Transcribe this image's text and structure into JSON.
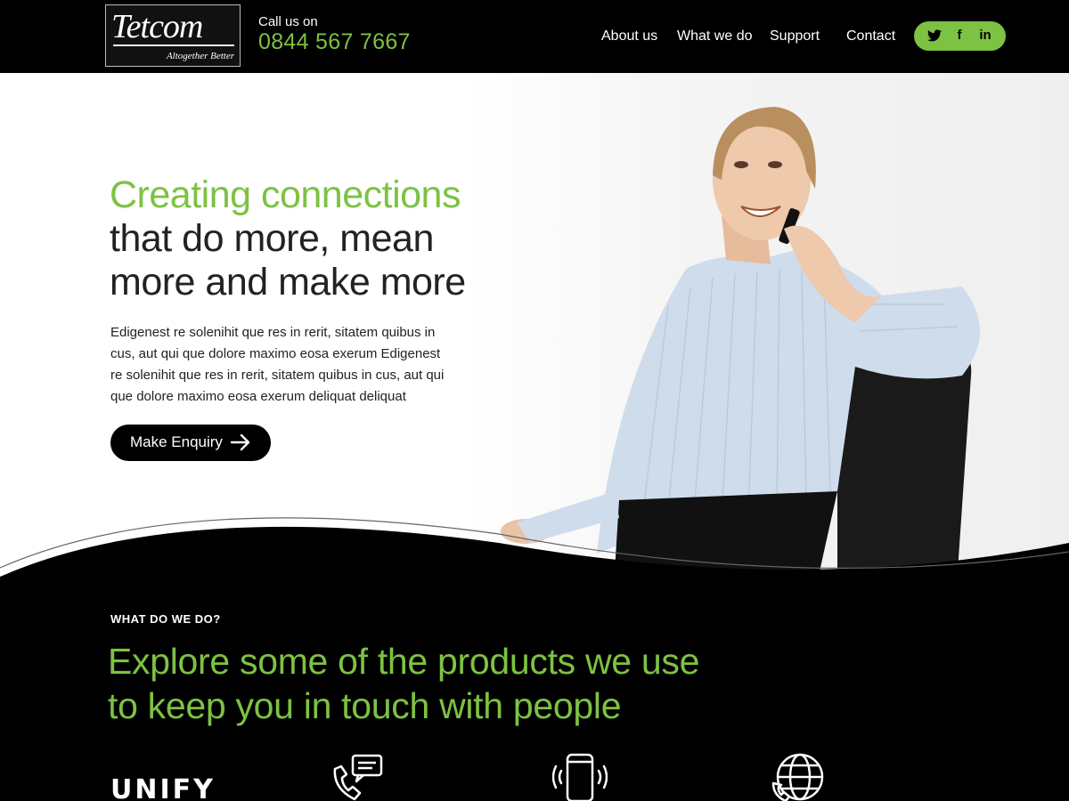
{
  "header": {
    "logo": {
      "name": "Tetcom",
      "tagline": "Altogether Better"
    },
    "call_label": "Call us on",
    "phone": "0844 567 7667",
    "nav": [
      {
        "label": "About us"
      },
      {
        "label": "What we do"
      },
      {
        "label": "Support"
      },
      {
        "label": "Contact"
      }
    ],
    "social": [
      {
        "icon": "twitter-icon",
        "glyph": "t"
      },
      {
        "icon": "facebook-icon",
        "glyph": "f"
      },
      {
        "icon": "linkedin-icon",
        "glyph": "in"
      }
    ]
  },
  "hero": {
    "title_line1": "Creating connections",
    "title_line2": "that do more, mean",
    "title_line3": "more and make more",
    "body": "Edigenest re solenihit que res in rerit, sitatem quibus in cus, aut qui que dolore maximo eosa exerum Edigenest re solenihit que res in rerit, sitatem quibus in cus, aut qui que dolore maximo eosa exerum deliquat deliquat",
    "cta_label": "Make Enquiry"
  },
  "section": {
    "eyebrow": "WHAT DO WE DO?",
    "title_line1": "Explore some of the products we use",
    "title_line2": "to keep you in touch with people",
    "products": [
      {
        "label": "UNIFY",
        "icon": "unify-logo"
      },
      {
        "icon": "phone-chat-icon"
      },
      {
        "icon": "mobile-phone-icon"
      },
      {
        "icon": "globe-phone-icon"
      }
    ]
  },
  "colors": {
    "accent": "#7dc242",
    "dark": "#000000"
  }
}
